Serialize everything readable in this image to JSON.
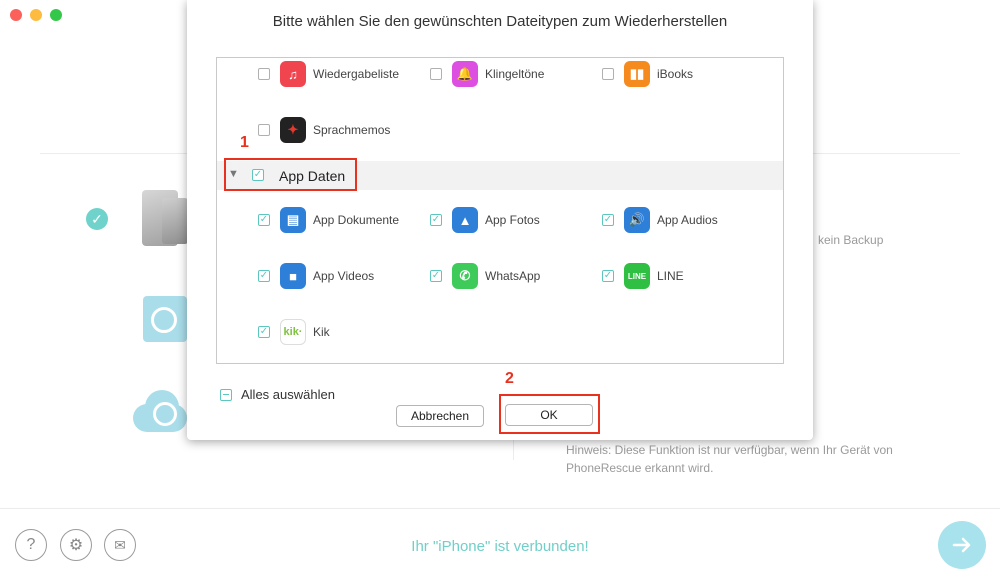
{
  "window": {
    "traffic_lights": [
      "#fc605b",
      "#fdbc40",
      "#34c84a"
    ]
  },
  "background": {
    "no_backup_text": "kein Backup",
    "hint_line1": "Hinweis: Diese Funktion ist nur verfügbar, wenn Ihr Gerät von",
    "hint_line2": "PhoneRescue erkannt wird.",
    "status": "Ihr \"iPhone\" ist verbunden!"
  },
  "footer_icons": [
    "help-icon",
    "settings-icon",
    "mail-icon"
  ],
  "dialog": {
    "title": "Bitte wählen Sie den gewünschten Dateitypen zum Wiederherstellen",
    "items_top": [
      {
        "label": "Wiedergabeliste",
        "checked": false,
        "icon": "playlist-icon"
      },
      {
        "label": "Klingeltöne",
        "checked": false,
        "icon": "ringtone-icon"
      },
      {
        "label": "iBooks",
        "checked": false,
        "icon": "ibooks-icon"
      },
      {
        "label": "Sprachmemos",
        "checked": false,
        "icon": "voice-memo-icon"
      }
    ],
    "group": {
      "label": "App Daten",
      "checked": true
    },
    "app_items": [
      {
        "label": "App Dokumente",
        "checked": true,
        "icon": "documents-icon"
      },
      {
        "label": "App Fotos",
        "checked": true,
        "icon": "photos-icon"
      },
      {
        "label": "App Audios",
        "checked": true,
        "icon": "audio-icon"
      },
      {
        "label": "App Videos",
        "checked": true,
        "icon": "video-icon"
      },
      {
        "label": "WhatsApp",
        "checked": true,
        "icon": "whatsapp-icon"
      },
      {
        "label": "LINE",
        "checked": true,
        "icon": "line-icon"
      },
      {
        "label": "Kik",
        "checked": true,
        "icon": "kik-icon"
      }
    ],
    "select_all": "Alles auswählen",
    "cancel": "Abbrechen",
    "ok": "OK"
  },
  "annotations": {
    "step1": "1",
    "step2": "2"
  }
}
